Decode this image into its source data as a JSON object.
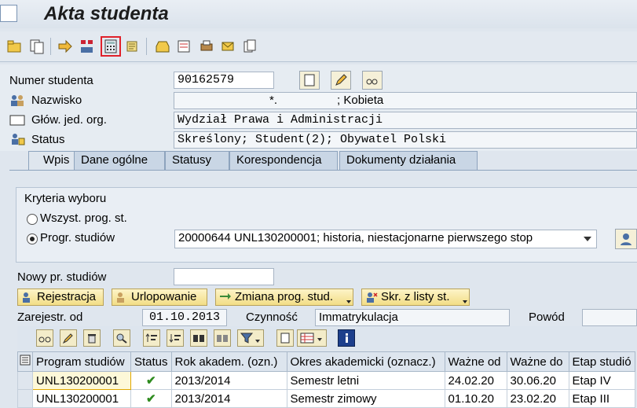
{
  "window": {
    "title": "Akta studenta"
  },
  "header": {
    "student_number": {
      "label": "Numer studenta",
      "value": "90162579"
    },
    "surname": {
      "label": "Nazwisko",
      "value": "*.",
      "suffix": "; Kobieta"
    },
    "org_unit": {
      "label": "Głów. jed. org.",
      "value": "Wydział Prawa i Administracji"
    },
    "status": {
      "label": "Status",
      "value": "Skreślony; Student(2); Obywatel Polski"
    }
  },
  "tabs": [
    {
      "label": "Wpis",
      "active": true
    },
    {
      "label": "Dane ogólne"
    },
    {
      "label": "Statusy"
    },
    {
      "label": "Korespondencja"
    },
    {
      "label": "Dokumenty działania"
    }
  ],
  "criteria": {
    "title": "Kryteria wyboru",
    "option_all": "Wszyst. prog. st.",
    "option_prog": "Progr. studiów",
    "selected_prog": "20000644 UNL130200001; historia, niestacjonarne pierwszego stop"
  },
  "new_prog": {
    "label": "Nowy pr. studiów",
    "value": ""
  },
  "actions": {
    "register": "Rejestracja",
    "leave": "Urlopowanie",
    "change_prog": "Zmiana prog. stud.",
    "remove": "Skr. z listy st."
  },
  "registration": {
    "date_label": "Zarejestr. od",
    "date_value": "01.10.2013",
    "activity_label": "Czynność",
    "activity_value": "Immatrykulacja",
    "reason_label": "Powód",
    "reason_value": ""
  },
  "grid": {
    "columns": [
      "Program studiów",
      "Status",
      "Rok akadem. (ozn.)",
      "Okres akademicki (oznacz.)",
      "Ważne od",
      "Ważne do",
      "Etap studió"
    ],
    "rows": [
      {
        "program": "UNL130200001",
        "status": "✔",
        "year": "2013/2014",
        "period": "Semestr letni",
        "from": "24.02.20",
        "to": "30.06.20",
        "stage": "Etap IV"
      },
      {
        "program": "UNL130200001",
        "status": "✔",
        "year": "2013/2014",
        "period": "Semestr zimowy",
        "from": "01.10.20",
        "to": "23.02.20",
        "stage": "Etap III"
      }
    ]
  },
  "colors": {
    "accent_highlight": "#e0212a",
    "status_ok": "#2e8b1e"
  }
}
